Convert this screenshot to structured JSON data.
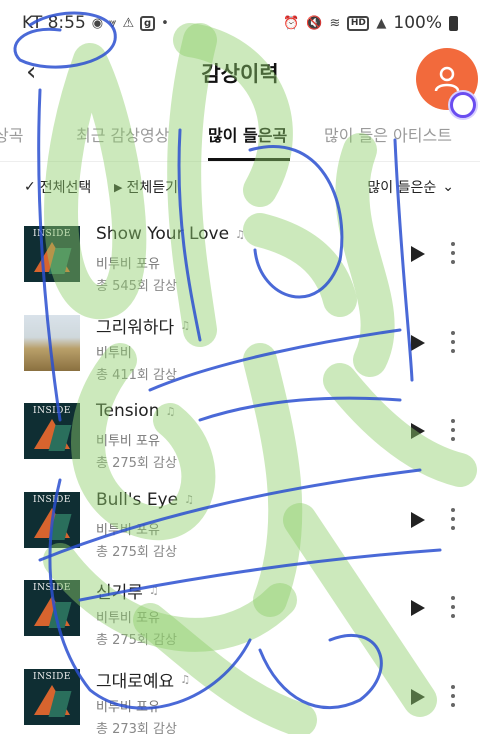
{
  "status_bar": {
    "carrier_time": "KT 8:55",
    "left_icons": [
      "app-icon",
      "signal-icon",
      "alert-icon",
      "g-icon"
    ],
    "dot": "•",
    "hd_label": "HD",
    "battery_text": "100%"
  },
  "header": {
    "title": "감상이력"
  },
  "tabs": [
    {
      "label": "상곡"
    },
    {
      "label": "최근 감상영상"
    },
    {
      "label": "많이 들은곡",
      "active": true
    },
    {
      "label": "많이 들은 아티스트"
    }
  ],
  "actions": {
    "select_all": "전체선택",
    "play_all": "전체듣기",
    "sort": "많이 들은순"
  },
  "songs": [
    {
      "title": "Show Your Love",
      "artist": "비투비 포유",
      "plays": "총 545회 감상",
      "art": "inside"
    },
    {
      "title": "그리워하다",
      "artist": "비투비",
      "plays": "총 411회 감상",
      "art": "field"
    },
    {
      "title": "Tension",
      "artist": "비투비 포유",
      "plays": "총 275회 감상",
      "art": "inside"
    },
    {
      "title": "Bull's Eye",
      "artist": "비투비 포유",
      "plays": "총 275회 감상",
      "art": "inside"
    },
    {
      "title": "신기루",
      "artist": "비투비 포유",
      "plays": "총 275회 감상",
      "art": "inside"
    },
    {
      "title": "그대로예요",
      "artist": "비투비 포유",
      "plays": "총 273회 감상",
      "art": "inside"
    }
  ],
  "album_label": "INSIDE",
  "colors": {
    "accent_avatar": "#f26a3c",
    "tab_active": "#111111",
    "tab_inactive": "#9a9a9a",
    "scribble_green": "#8fcf6a",
    "scribble_blue": "#2a4fd0"
  }
}
